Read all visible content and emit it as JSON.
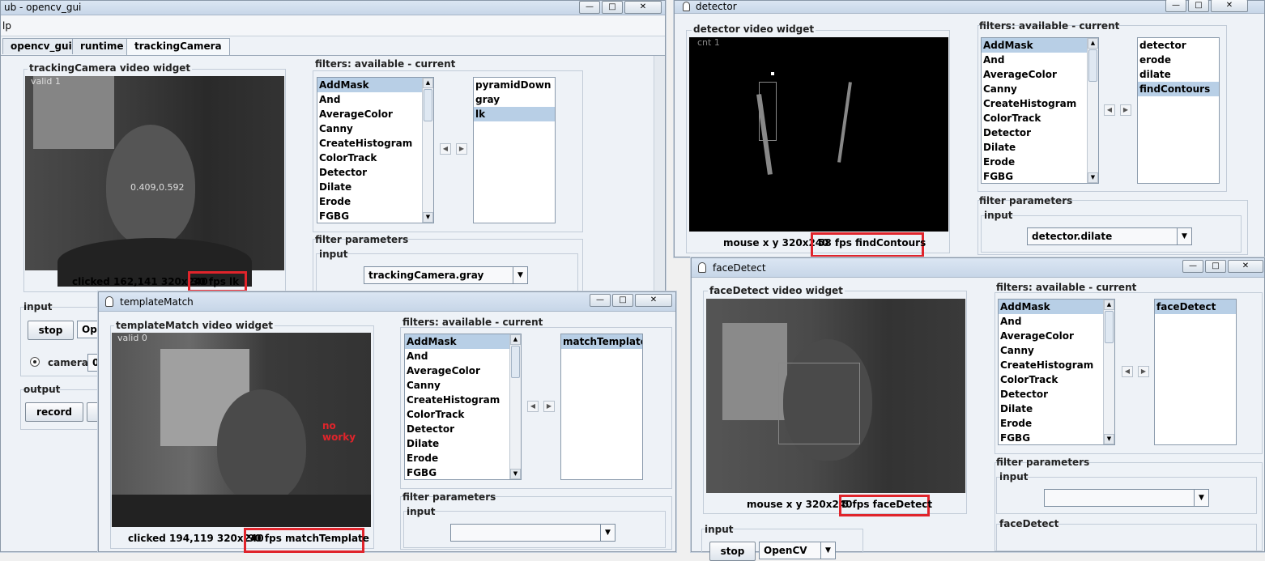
{
  "main": {
    "title": "ub - opencv_gui",
    "menu": "lp",
    "tabs": [
      {
        "label": "opencv_gui"
      },
      {
        "label": "runtime"
      },
      {
        "label": "trackingCamera"
      }
    ],
    "video_label": "trackingCamera  video widget",
    "video_overlay": "valid 1",
    "coord_overlay": "0.409,0.592",
    "status": "clicked 162,141  320x240",
    "status_hl": "30 fps  lk",
    "filters_label": "filters: available - current",
    "available": [
      "AddMask",
      "And",
      "AverageColor",
      "Canny",
      "CreateHistogram",
      "ColorTrack",
      "Detector",
      "Dilate",
      "Erode",
      "FGBG"
    ],
    "current": [
      "pyramidDown",
      "gray",
      "lk"
    ],
    "params_label": "filter parameters",
    "input_label": "input",
    "combo_value": "trackingCamera.gray",
    "input_section": "input",
    "stop": "stop",
    "ope": "Ope",
    "camera": "camera",
    "camera_val": "0",
    "output_section": "output",
    "record": "record"
  },
  "detector": {
    "title": "detector",
    "video_label": "detector  video widget",
    "video_overlay": "cnt 1",
    "status": "mouse x y  320x240",
    "status_hl": "58 fps  findContours",
    "filters_label": "filters: available - current",
    "available": [
      "AddMask",
      "And",
      "AverageColor",
      "Canny",
      "CreateHistogram",
      "ColorTrack",
      "Detector",
      "Dilate",
      "Erode",
      "FGBG"
    ],
    "current": [
      "detector",
      "erode",
      "dilate",
      "findContours"
    ],
    "params_label": "filter parameters",
    "input_label": "input",
    "combo_value": "detector.dilate"
  },
  "templateMatch": {
    "title": "templateMatch",
    "video_label": "templateMatch  video widget",
    "video_overlay": "valid 0",
    "note": "no worky",
    "status": "clicked 194,119  320x240",
    "status_hl": "90 fps  matchTemplate",
    "filters_label": "filters: available - current",
    "available": [
      "AddMask",
      "And",
      "AverageColor",
      "Canny",
      "CreateHistogram",
      "ColorTrack",
      "Detector",
      "Dilate",
      "Erode",
      "FGBG"
    ],
    "current": [
      "matchTemplate"
    ],
    "params_label": "filter parameters",
    "input_label": "input"
  },
  "faceDetect": {
    "title": "faceDetect",
    "video_label": "faceDetect  video widget",
    "status": "mouse x y  320x240",
    "status_hl": "5 fps  faceDetect",
    "filters_label": "filters: available - current",
    "available": [
      "AddMask",
      "And",
      "AverageColor",
      "Canny",
      "CreateHistogram",
      "ColorTrack",
      "Detector",
      "Dilate",
      "Erode",
      "FGBG"
    ],
    "current": [
      "faceDetect"
    ],
    "params_label": "filter parameters",
    "input_label": "input",
    "param_section": "faceDetect",
    "input_section": "input",
    "stop": "stop",
    "opencv": "OpenCV"
  },
  "colors": {
    "highlight": "#e0242b",
    "selection": "#b8cfe6",
    "note": "#e0242b"
  },
  "icons": [
    "minimize-icon",
    "maximize-icon",
    "close-icon",
    "java-cup-icon",
    "chevron-down-icon",
    "arrow-left-icon",
    "arrow-right-icon"
  ]
}
